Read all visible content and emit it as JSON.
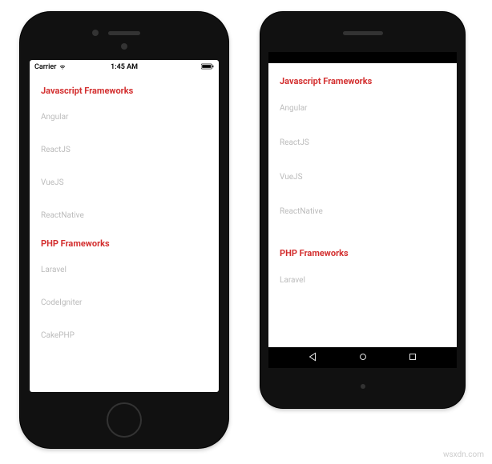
{
  "ios": {
    "statusbar": {
      "carrier": "Carrier",
      "time": "1:45 AM"
    }
  },
  "sections": [
    {
      "title": "Javascript Frameworks",
      "items": [
        "Angular",
        "ReactJS",
        "VueJS",
        "ReactNative"
      ]
    },
    {
      "title": "PHP Frameworks",
      "items": [
        "Laravel",
        "CodeIgniter",
        "CakePHP"
      ]
    }
  ],
  "android_sections": [
    {
      "title": "Javascript Frameworks",
      "items": [
        "Angular",
        "ReactJS",
        "VueJS",
        "ReactNative"
      ]
    },
    {
      "title": "PHP Frameworks",
      "items": [
        "Laravel"
      ]
    }
  ],
  "watermark": "wsxdn.com"
}
